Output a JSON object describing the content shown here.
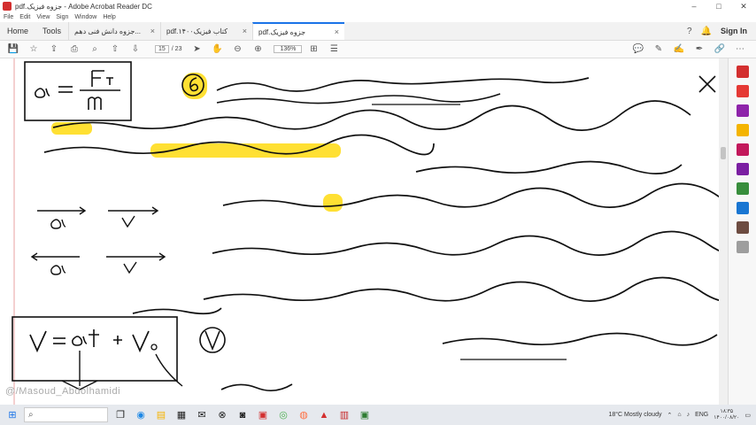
{
  "window": {
    "title": "pdf.جزوه فیزیک - Adobe Acrobat Reader DC",
    "controls": [
      "–",
      "□",
      "✕"
    ]
  },
  "menu": [
    "File",
    "Edit",
    "View",
    "Sign",
    "Window",
    "Help"
  ],
  "tabs": {
    "home": "Home",
    "tools": "Tools",
    "docs": [
      {
        "label": "جزوه دانش فنی دهم...",
        "close": "×"
      },
      {
        "label": "pdf.کتاب فیزیک۱۴۰۰",
        "close": "×"
      },
      {
        "label": "pdf.جزوه فیزیک",
        "close": "×"
      }
    ],
    "sign_in": "Sign In"
  },
  "toolbar": {
    "page_current": "15",
    "page_total": "/ 23",
    "zoom": "136%"
  },
  "page": {
    "watermark": "@/Masoud_Abdolhamidi"
  },
  "taskbar": {
    "search_icon": "search-icon",
    "weather": "18°C  Mostly cloudy",
    "lang": "ENG",
    "time": "۱۸:۳۵",
    "date": "۱۴۰۰/۰۸/۲۰"
  },
  "colors": {
    "highlight": "#ffe033",
    "ink": "#111111",
    "accent": "#1a73e8"
  }
}
